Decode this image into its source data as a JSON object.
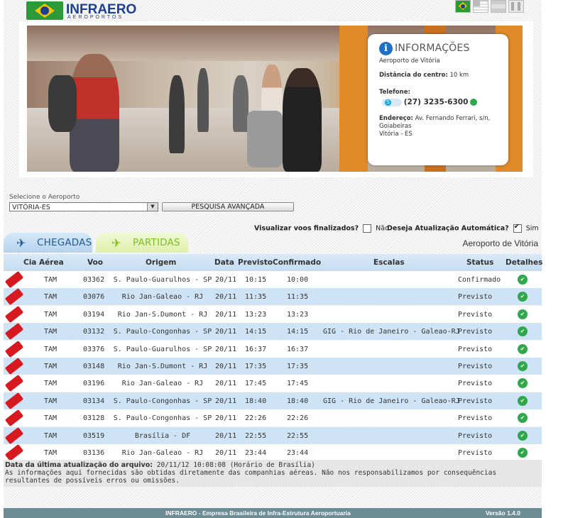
{
  "header": {
    "logo_word": "INFRAERO",
    "logo_sub": "AEROPORTOS",
    "languages": [
      "pt-br-flag-icon",
      "en-us-flag-icon",
      "es-flag-icon",
      "accessibility-icon"
    ]
  },
  "info": {
    "title": "INFORMAÇÕES",
    "airport": "Aeroporto de Vitória",
    "distance_label": "Distância do centro:",
    "distance_value": "10 km",
    "phone_label": "Telefone:",
    "phone_value": "(27) 3235-6300",
    "address_label": "Endereço:",
    "address_value": "Av. Fernando Ferrari, s/n,",
    "address_line2": "Goiabeiras",
    "address_line3": "Vitória - ES"
  },
  "search": {
    "label": "Selecione o Aeroporto",
    "selected": "VITÓRIA-ES",
    "advanced_button": "PESQUISA AVANÇADA",
    "finalized_label": "Visualizar voos finalizados?",
    "finalized_value": "Não",
    "auto_label": "Deseja Atualização Automática?",
    "auto_value": "Sim"
  },
  "tabs": {
    "arrivals": "CHEGADAS",
    "departures": "PARTIDAS"
  },
  "airport_title": "Aeroporto de Vitória",
  "table": {
    "headers": {
      "airline": "Cia Aérea",
      "flight": "Voo",
      "origin": "Origem",
      "date": "Data",
      "scheduled": "Previsto",
      "confirmed": "Confirmado",
      "stops": "Escalas",
      "status": "Status",
      "details": "Detalhes"
    },
    "rows": [
      {
        "airline": "TAM",
        "flight": "03362",
        "origin": "S. Paulo-Guarulhos - SP",
        "date": "20/11",
        "scheduled": "10:15",
        "confirmed": "10:00",
        "stops": "",
        "status": "Confirmado"
      },
      {
        "airline": "TAM",
        "flight": "03076",
        "origin": "Rio Jan-Galeao - RJ",
        "date": "20/11",
        "scheduled": "11:35",
        "confirmed": "11:35",
        "stops": "",
        "status": "Previsto"
      },
      {
        "airline": "TAM",
        "flight": "03194",
        "origin": "Rio Jan-S.Dumont - RJ",
        "date": "20/11",
        "scheduled": "13:23",
        "confirmed": "13:23",
        "stops": "",
        "status": "Previsto"
      },
      {
        "airline": "TAM",
        "flight": "03132",
        "origin": "S. Paulo-Congonhas - SP",
        "date": "20/11",
        "scheduled": "14:15",
        "confirmed": "14:15",
        "stops": "GIG - Rio de Janeiro - Galeao-RJ",
        "status": "Previsto"
      },
      {
        "airline": "TAM",
        "flight": "03376",
        "origin": "S. Paulo-Guarulhos - SP",
        "date": "20/11",
        "scheduled": "16:37",
        "confirmed": "16:37",
        "stops": "",
        "status": "Previsto"
      },
      {
        "airline": "TAM",
        "flight": "03148",
        "origin": "Rio Jan-S.Dumont - RJ",
        "date": "20/11",
        "scheduled": "17:35",
        "confirmed": "17:35",
        "stops": "",
        "status": "Previsto"
      },
      {
        "airline": "TAM",
        "flight": "03196",
        "origin": "Rio Jan-Galeao - RJ",
        "date": "20/11",
        "scheduled": "17:45",
        "confirmed": "17:45",
        "stops": "",
        "status": "Previsto"
      },
      {
        "airline": "TAM",
        "flight": "03134",
        "origin": "S. Paulo-Congonhas - SP",
        "date": "20/11",
        "scheduled": "18:40",
        "confirmed": "18:40",
        "stops": "GIG - Rio de Janeiro - Galeao-RJ",
        "status": "Previsto"
      },
      {
        "airline": "TAM",
        "flight": "03128",
        "origin": "S. Paulo-Congonhas - SP",
        "date": "20/11",
        "scheduled": "22:26",
        "confirmed": "22:26",
        "stops": "",
        "status": "Previsto"
      },
      {
        "airline": "TAM",
        "flight": "03519",
        "origin": "Brasília - DF",
        "date": "20/11",
        "scheduled": "22:55",
        "confirmed": "22:55",
        "stops": "",
        "status": "Previsto"
      },
      {
        "airline": "TAM",
        "flight": "03136",
        "origin": "Rio Jan-Galeao - RJ",
        "date": "20/11",
        "scheduled": "23:44",
        "confirmed": "23:44",
        "stops": "",
        "status": "Previsto"
      }
    ]
  },
  "notes": {
    "update_label": "Data da última atualização do arquivo:",
    "update_value": "20/11/12 10:08:08 (Horário de Brasília)",
    "disclaimer": "As informações aqui fornecidas são obtidas diretamente das companhias aéreas. Não nos responsabilizamos por consequências resultantes de possíveis erros ou omissões."
  },
  "footer": {
    "company": "INFRAERO - Empresa Brasileira de Infra-Estrutura Aeroportuaria",
    "version": "Versão 1.4.0"
  }
}
